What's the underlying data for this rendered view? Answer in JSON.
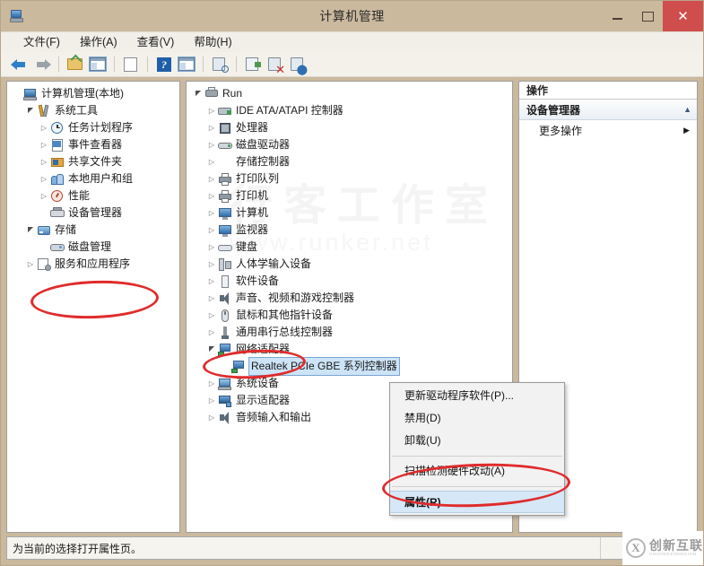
{
  "window": {
    "title": "计算机管理",
    "icon": "computer-management-icon",
    "buttons": {
      "minimize": "—",
      "maximize": "▢",
      "close": "✕"
    }
  },
  "menubar": {
    "items": [
      {
        "label": "文件(F)"
      },
      {
        "label": "操作(A)"
      },
      {
        "label": "查看(V)"
      },
      {
        "label": "帮助(H)"
      }
    ]
  },
  "toolbar": {
    "items": [
      {
        "name": "back-arrow-icon"
      },
      {
        "name": "forward-arrow-icon"
      },
      {
        "name": "up-folder-icon"
      },
      {
        "name": "show-console-tree-icon"
      },
      {
        "name": "properties-page-icon"
      },
      {
        "name": "help-icon"
      },
      {
        "name": "show-action-pane-icon"
      },
      {
        "name": "scan-devices-icon"
      },
      {
        "name": "update-driver-icon"
      },
      {
        "name": "uninstall-device-icon"
      },
      {
        "name": "add-legacy-hardware-icon"
      }
    ]
  },
  "left_tree": {
    "nodes": [
      {
        "label": "计算机管理(本地)",
        "indent": 0,
        "expander": "none",
        "icon": "i-computer"
      },
      {
        "label": "系统工具",
        "indent": 1,
        "expander": "open",
        "icon": "i-tools"
      },
      {
        "label": "任务计划程序",
        "indent": 2,
        "expander": "closed",
        "icon": "i-clock"
      },
      {
        "label": "事件查看器",
        "indent": 2,
        "expander": "closed",
        "icon": "i-event"
      },
      {
        "label": "共享文件夹",
        "indent": 2,
        "expander": "closed",
        "icon": "i-share"
      },
      {
        "label": "本地用户和组",
        "indent": 2,
        "expander": "closed",
        "icon": "i-users"
      },
      {
        "label": "性能",
        "indent": 2,
        "expander": "closed",
        "icon": "i-perf"
      },
      {
        "label": "设备管理器",
        "indent": 2,
        "expander": "none",
        "icon": "i-devmgr"
      },
      {
        "label": "存储",
        "indent": 1,
        "expander": "open",
        "icon": "i-storage"
      },
      {
        "label": "磁盘管理",
        "indent": 2,
        "expander": "none",
        "icon": "i-disk"
      },
      {
        "label": "服务和应用程序",
        "indent": 1,
        "expander": "closed",
        "icon": "i-services"
      }
    ]
  },
  "device_tree": {
    "nodes": [
      {
        "label": "Run",
        "indent": 0,
        "expander": "open",
        "icon": "i-run"
      },
      {
        "label": "IDE ATA/ATAPI 控制器",
        "indent": 1,
        "expander": "closed",
        "icon": "i-ide"
      },
      {
        "label": "处理器",
        "indent": 1,
        "expander": "closed",
        "icon": "i-cpu"
      },
      {
        "label": "磁盘驱动器",
        "indent": 1,
        "expander": "closed",
        "icon": "i-hdd"
      },
      {
        "label": "存储控制器",
        "indent": 1,
        "expander": "closed",
        "icon": "i-ctrl"
      },
      {
        "label": "打印队列",
        "indent": 1,
        "expander": "closed",
        "icon": "i-print"
      },
      {
        "label": "打印机",
        "indent": 1,
        "expander": "closed",
        "icon": "i-print"
      },
      {
        "label": "计算机",
        "indent": 1,
        "expander": "closed",
        "icon": "i-monitor"
      },
      {
        "label": "监视器",
        "indent": 1,
        "expander": "closed",
        "icon": "i-monitor"
      },
      {
        "label": "键盘",
        "indent": 1,
        "expander": "closed",
        "icon": "i-kbd"
      },
      {
        "label": "人体学输入设备",
        "indent": 1,
        "expander": "closed",
        "icon": "i-hid"
      },
      {
        "label": "软件设备",
        "indent": 1,
        "expander": "closed",
        "icon": "i-soft"
      },
      {
        "label": "声音、视频和游戏控制器",
        "indent": 1,
        "expander": "closed",
        "icon": "i-sound"
      },
      {
        "label": "鼠标和其他指针设备",
        "indent": 1,
        "expander": "closed",
        "icon": "i-mouse"
      },
      {
        "label": "通用串行总线控制器",
        "indent": 1,
        "expander": "closed",
        "icon": "i-usb"
      },
      {
        "label": "网络适配器",
        "indent": 1,
        "expander": "open",
        "icon": "i-net"
      },
      {
        "label": "Realtek PCIe GBE 系列控制器",
        "indent": 2,
        "expander": "none",
        "icon": "i-net",
        "selected": true
      },
      {
        "label": "系统设备",
        "indent": 1,
        "expander": "closed",
        "icon": "i-sys"
      },
      {
        "label": "显示适配器",
        "indent": 1,
        "expander": "closed",
        "icon": "i-disp"
      },
      {
        "label": "音频输入和输出",
        "indent": 1,
        "expander": "closed",
        "icon": "i-audio"
      }
    ]
  },
  "context_menu": {
    "items": [
      {
        "label": "更新驱动程序软件(P)...",
        "highlight": false
      },
      {
        "label": "禁用(D)",
        "highlight": false
      },
      {
        "label": "卸载(U)",
        "highlight": false
      },
      {
        "separator": true
      },
      {
        "label": "扫描检测硬件改动(A)",
        "highlight": false
      },
      {
        "separator": true
      },
      {
        "label": "属性(R)",
        "highlight": true
      }
    ]
  },
  "actions_pane": {
    "header": "操作",
    "group_title": "设备管理器",
    "collapse_icon": "▲",
    "items": [
      {
        "label": "更多操作",
        "submenu_icon": "▶"
      }
    ]
  },
  "statusbar": {
    "text": "为当前的选择打开属性页。"
  },
  "watermark": {
    "main": "行客工作室",
    "sub": "www.runker.net"
  },
  "logo": {
    "cn": "创新互联",
    "en": "CHUANGXINHULIAN"
  },
  "colors": {
    "titlebar": "#cbb99e",
    "close_button": "#cf4d4d",
    "selection": "#cde4f7",
    "annotation_red": "#e02b2b",
    "menu_highlight": "#d6e7f7"
  }
}
